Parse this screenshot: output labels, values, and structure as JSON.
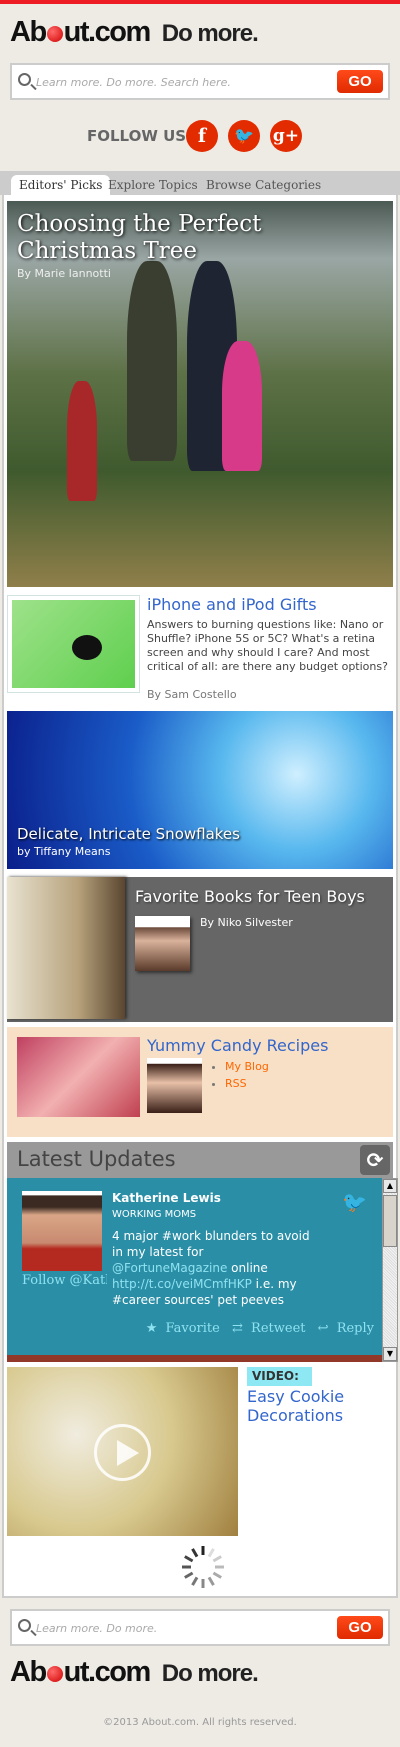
{
  "header": {
    "logo_text": "About.com",
    "tagline": "Do more.",
    "search_placeholder": "Learn more. Do more. Search here.",
    "go_label": "GO",
    "follow_label": "FOLLOW US:",
    "social": [
      "facebook-icon",
      "twitter-icon",
      "google-plus-icon"
    ]
  },
  "tabs": [
    {
      "label": "Editors' Picks",
      "active": true
    },
    {
      "label": "Explore Topics"
    },
    {
      "label": "Browse Categories"
    }
  ],
  "hero": {
    "title": "Choosing the Perfect Christmas Tree",
    "byline": "By Marie Iannotti"
  },
  "iphone": {
    "title": "iPhone and iPod Gifts",
    "description": "Answers to burning questions like: Nano or Shuffle? iPhone 5S or 5C? What's a retina screen and why should I care? And most critical of all: are there any budget options?",
    "byline": "By Sam Costello"
  },
  "snowflakes": {
    "title": "Delicate, Intricate Snowflakes",
    "byline": "by Tiffany Means"
  },
  "teen": {
    "title": "Favorite Books for Teen Boys",
    "byline": "By Niko Silvester"
  },
  "candy": {
    "title": "Yummy Candy Recipes",
    "links": [
      "My Blog",
      "RSS"
    ]
  },
  "latest": {
    "title": "Latest Updates",
    "tweet": {
      "name": "Katherine Lewis",
      "category": "WORKING MOMS",
      "text_1": "4 major #work blunders to avoid in my latest for",
      "mention": "@FortuneMagazine",
      "text_2": " online ",
      "link": "http://t.co/veiMCmfHKP",
      "text_3": " i.e. my #career sources' pet peeves",
      "follow": "Follow @KatherineLewis",
      "favorite": "Favorite",
      "retweet": "Retweet",
      "reply": "Reply"
    }
  },
  "video": {
    "label": "VIDEO:",
    "title": "Easy Cookie Decorations"
  },
  "footer": {
    "search_placeholder": "Learn more. Do more.",
    "go_label": "GO",
    "logo_text": "About.com",
    "tagline": "Do more.",
    "copyright": "©2013 About.com. All rights reserved."
  },
  "colors": {
    "accent": "#ee1c24",
    "link": "#3366cc",
    "teal": "#2a8ea6",
    "candy_bg": "#f7e0c6"
  }
}
